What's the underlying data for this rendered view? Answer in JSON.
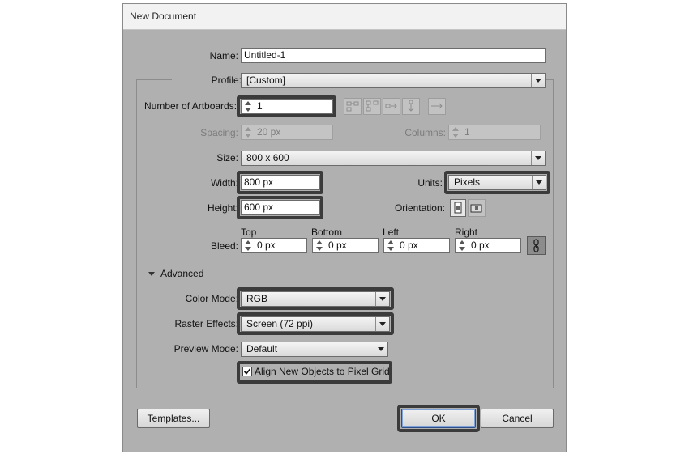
{
  "dialog": {
    "title": "New Document"
  },
  "name": {
    "label": "Name:",
    "value": "Untitled-1"
  },
  "profile": {
    "label": "Profile:",
    "value": "[Custom]"
  },
  "artboards": {
    "label": "Number of Artboards:",
    "value": "1"
  },
  "spacing": {
    "label": "Spacing:",
    "value": "20 px"
  },
  "columns": {
    "label": "Columns:",
    "value": "1"
  },
  "size": {
    "label": "Size:",
    "value": "800 x 600"
  },
  "width": {
    "label": "Width:",
    "value": "800 px"
  },
  "units": {
    "label": "Units:",
    "value": "Pixels"
  },
  "height": {
    "label": "Height:",
    "value": "600 px"
  },
  "orientation": {
    "label": "Orientation:"
  },
  "bleed": {
    "label": "Bleed:",
    "top": {
      "label": "Top",
      "value": "0 px"
    },
    "bottom": {
      "label": "Bottom",
      "value": "0 px"
    },
    "left": {
      "label": "Left",
      "value": "0 px"
    },
    "right": {
      "label": "Right",
      "value": "0 px"
    }
  },
  "advanced": {
    "label": "Advanced",
    "color_mode": {
      "label": "Color Mode:",
      "value": "RGB"
    },
    "raster_effects": {
      "label": "Raster Effects:",
      "value": "Screen (72 ppi)"
    },
    "preview_mode": {
      "label": "Preview Mode:",
      "value": "Default"
    },
    "align_grid": {
      "label": "Align New Objects to Pixel Grid",
      "checked": true
    }
  },
  "buttons": {
    "templates": "Templates...",
    "ok": "OK",
    "cancel": "Cancel"
  }
}
